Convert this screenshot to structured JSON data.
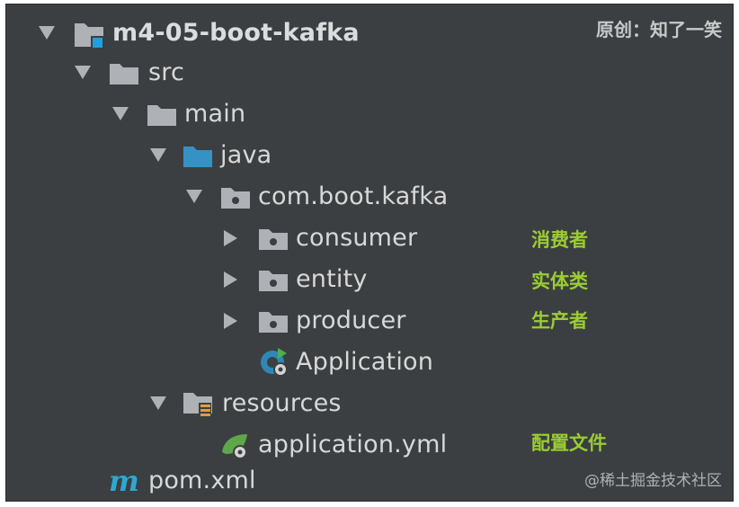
{
  "tree": {
    "root": {
      "label": "m4-05-boot-kafka"
    },
    "src": {
      "label": "src"
    },
    "main": {
      "label": "main"
    },
    "java": {
      "label": "java"
    },
    "pkg": {
      "label": "com.boot.kafka"
    },
    "consumer": {
      "label": "consumer",
      "note": "消费者"
    },
    "entity": {
      "label": "entity",
      "note": "实体类"
    },
    "producer": {
      "label": "producer",
      "note": "生产者"
    },
    "application": {
      "label": "Application"
    },
    "resources": {
      "label": "resources"
    },
    "yml": {
      "label": "application.yml",
      "note": "配置文件"
    },
    "pom": {
      "label": "pom.xml"
    }
  },
  "watermark": {
    "top": "原创：知了一笑",
    "bottom": "@稀土掘金技术社区"
  },
  "colors": {
    "background": "#3c3f41",
    "text": "#d8d8d8",
    "folder": "#aeb1b5",
    "source_folder": "#3592c4",
    "annotation": "#9acd32",
    "maven": "#2fa8cf"
  }
}
